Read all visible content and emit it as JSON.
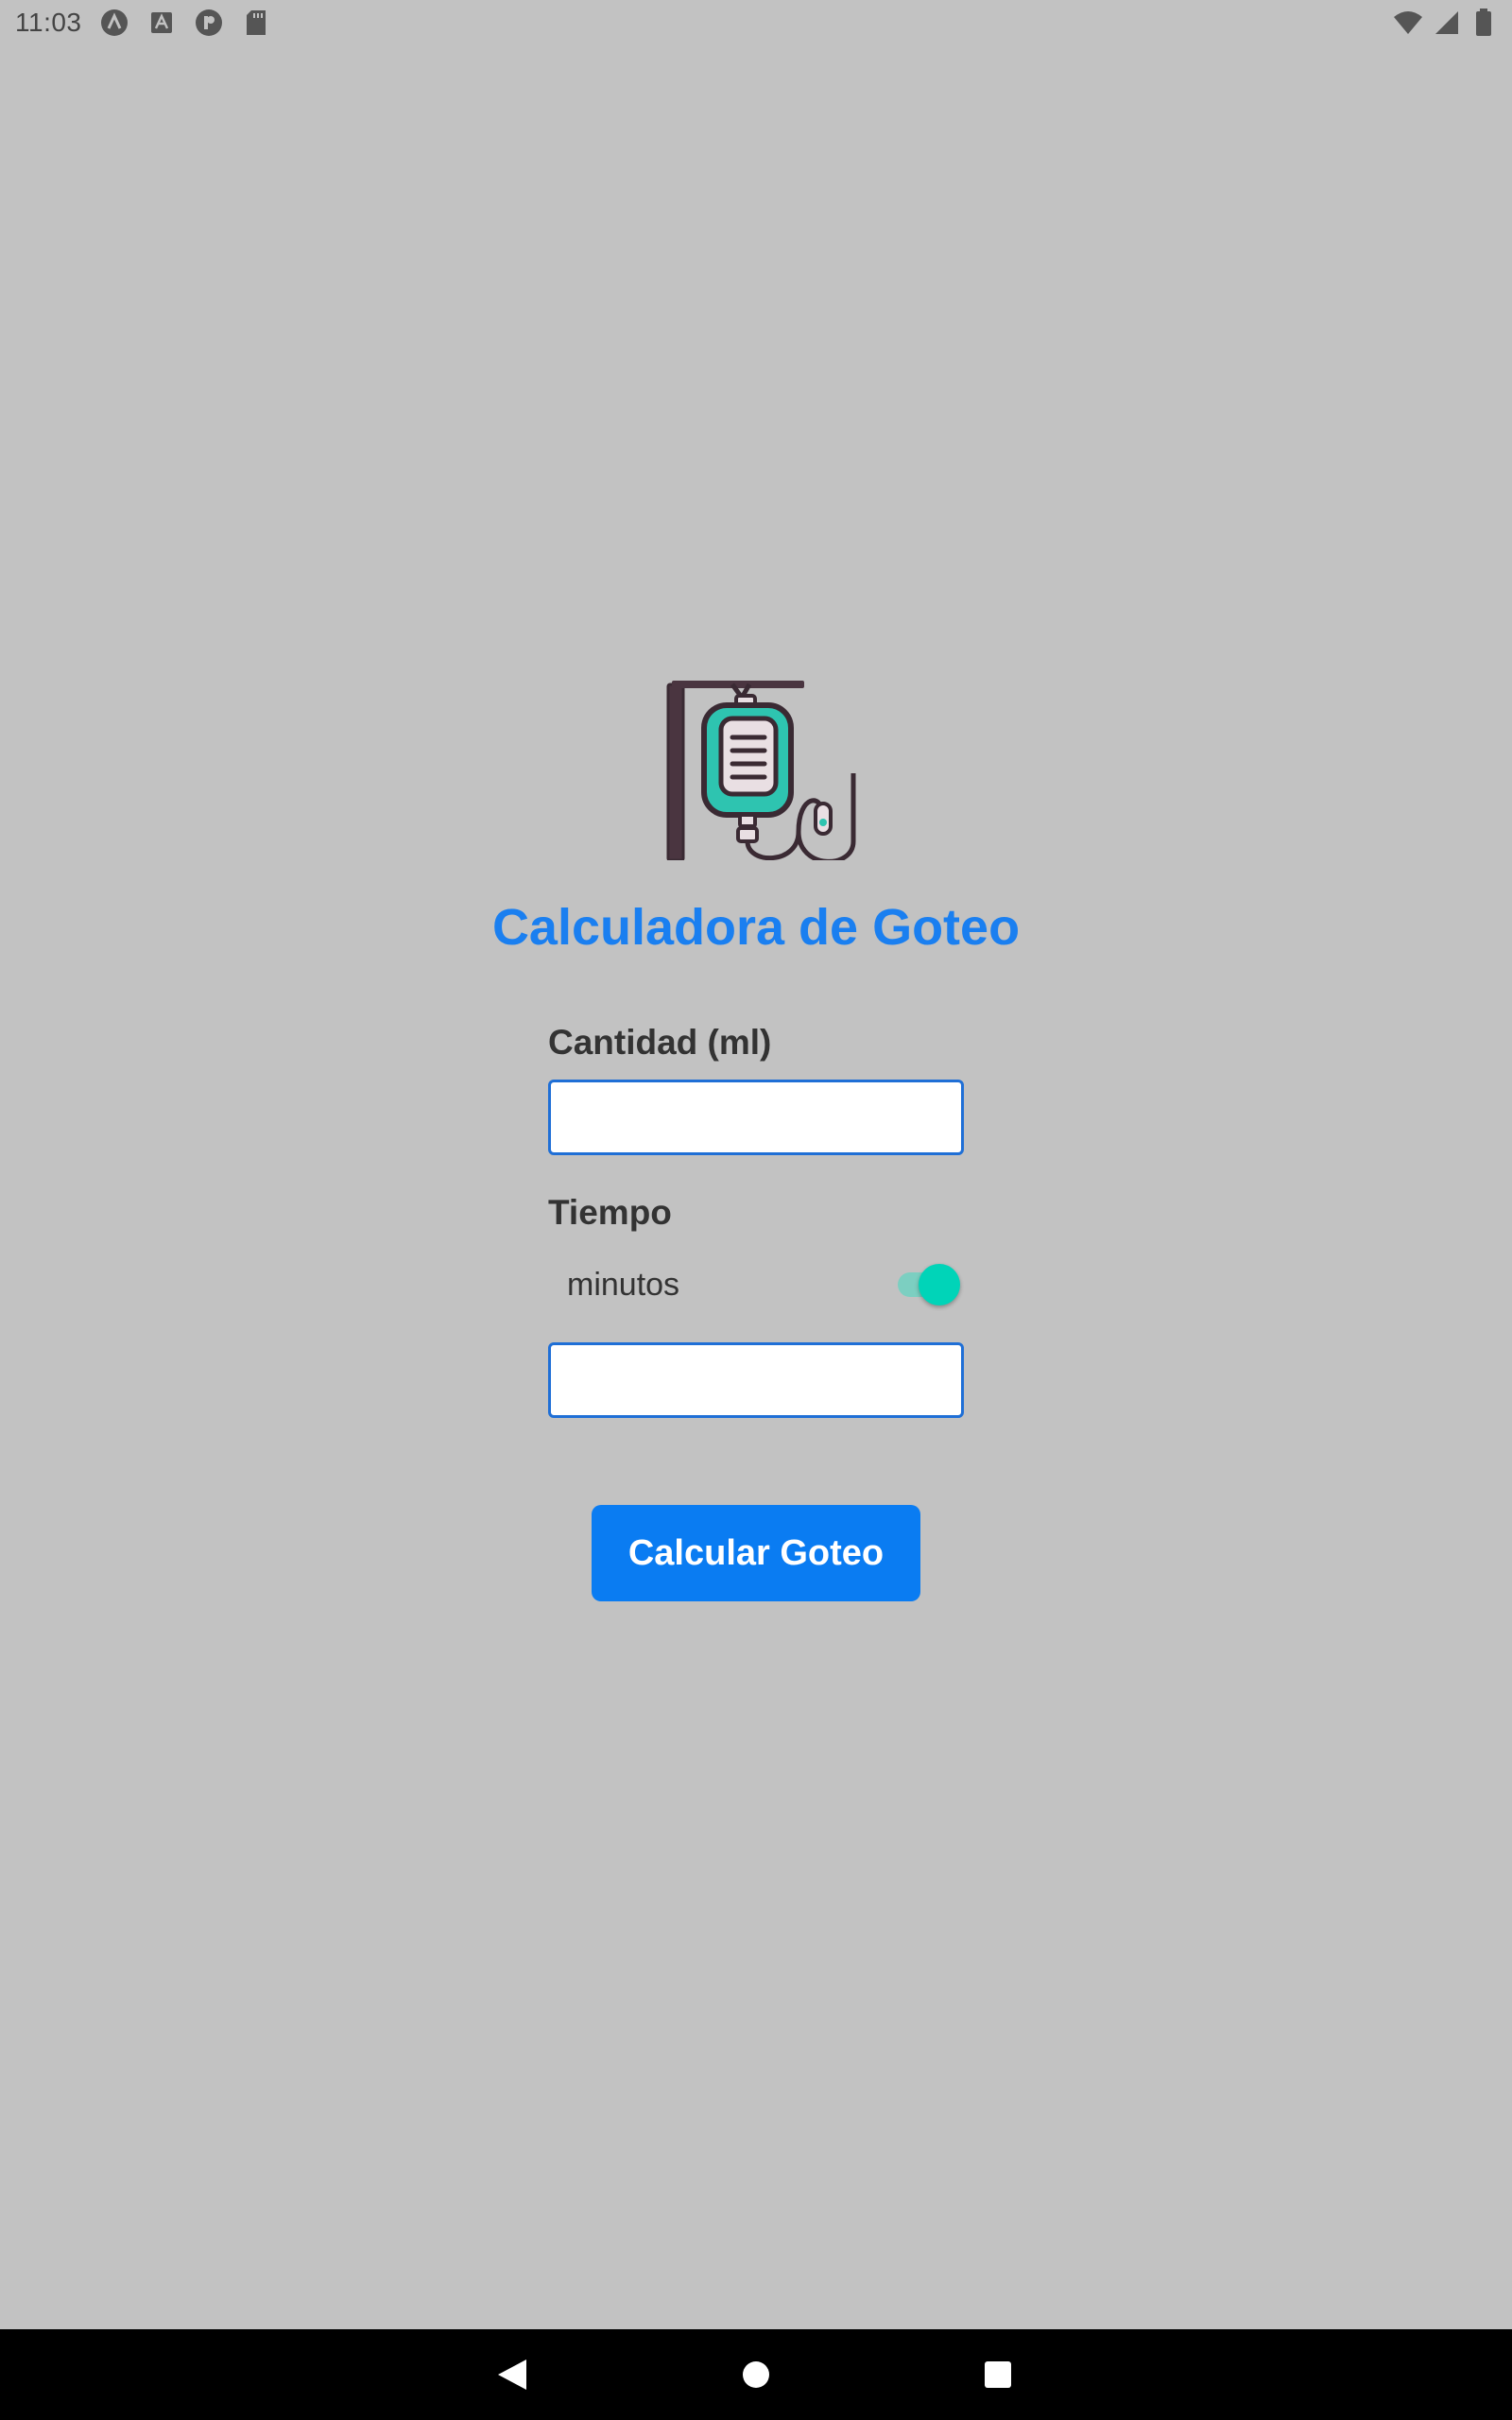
{
  "status_bar": {
    "time": "11:03",
    "left_icons": [
      "app-a-circle-icon",
      "text-a-box-icon",
      "p-circle-icon",
      "sd-card-icon"
    ],
    "right_icons": [
      "wifi-icon",
      "signal-icon",
      "battery-icon"
    ]
  },
  "app": {
    "logo_icon": "iv-drip-bag-icon",
    "title": "Calculadora de Goteo"
  },
  "form": {
    "quantity_label": "Cantidad (ml)",
    "quantity_value": "",
    "time_label": "Tiempo",
    "unit_toggle_label": "minutos",
    "unit_toggle_on": true,
    "time_value": "",
    "submit_label": "Calcular Goteo"
  },
  "colors": {
    "background": "#c2c2c2",
    "title": "#1a7ff0",
    "button": "#0a7cf2",
    "toggle_thumb": "#00d4b8",
    "input_border": "#1f6fd6"
  },
  "nav_bar": {
    "icons": [
      "back-triangle-icon",
      "home-circle-icon",
      "recents-square-icon"
    ]
  }
}
